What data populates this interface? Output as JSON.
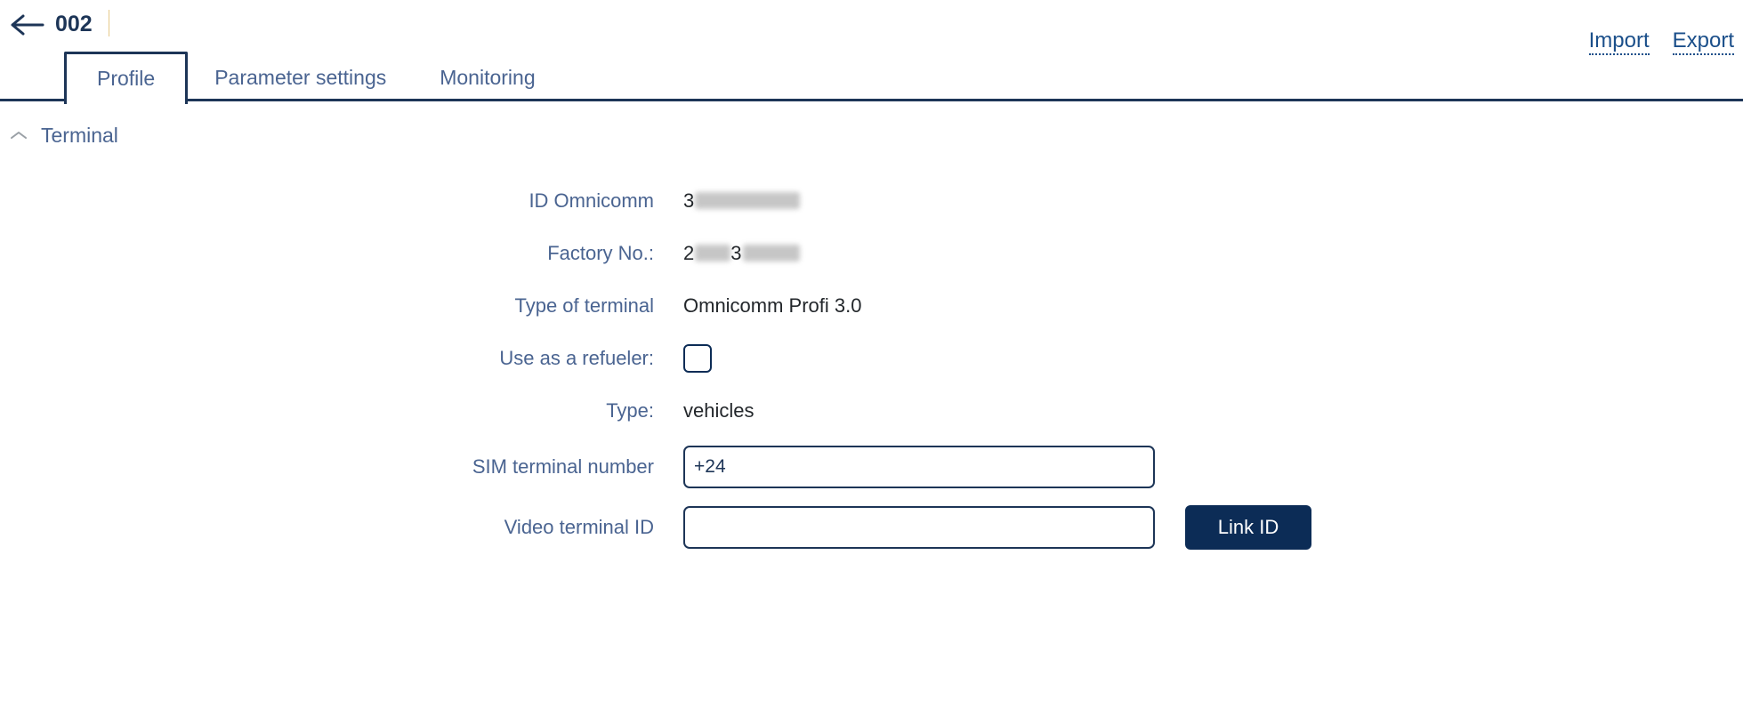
{
  "header": {
    "back_icon": "arrow-left-icon",
    "title": "002",
    "import_label": "Import",
    "export_label": "Export"
  },
  "tabs": [
    {
      "label": "Profile",
      "active": true
    },
    {
      "label": "Parameter settings",
      "active": false
    },
    {
      "label": "Monitoring",
      "active": false
    }
  ],
  "section": {
    "collapse_icon": "chevron-up-icon",
    "title": "Terminal"
  },
  "form": {
    "id_omnicomm": {
      "label": "ID Omnicomm",
      "value_prefix": "3",
      "redacted": true
    },
    "factory_no": {
      "label": "Factory No.:",
      "value_prefix": "2",
      "value_mid": "3",
      "redacted": true
    },
    "type_of_terminal": {
      "label": "Type of terminal",
      "value": "Omnicomm Profi 3.0"
    },
    "use_as_refueler": {
      "label": "Use as a refueler:",
      "checked": false
    },
    "type": {
      "label": "Type:",
      "value": "vehicles"
    },
    "sim_terminal_number": {
      "label": "SIM terminal number",
      "value": "+24",
      "placeholder": ""
    },
    "video_terminal_id": {
      "label": "Video terminal ID",
      "value": "",
      "placeholder": ""
    },
    "link_id_button": "Link ID"
  },
  "colors": {
    "accent_navy": "#1d3557",
    "label_blue": "#4a6491",
    "link_blue": "#1b4f8a",
    "button_navy": "#0c2c56"
  }
}
